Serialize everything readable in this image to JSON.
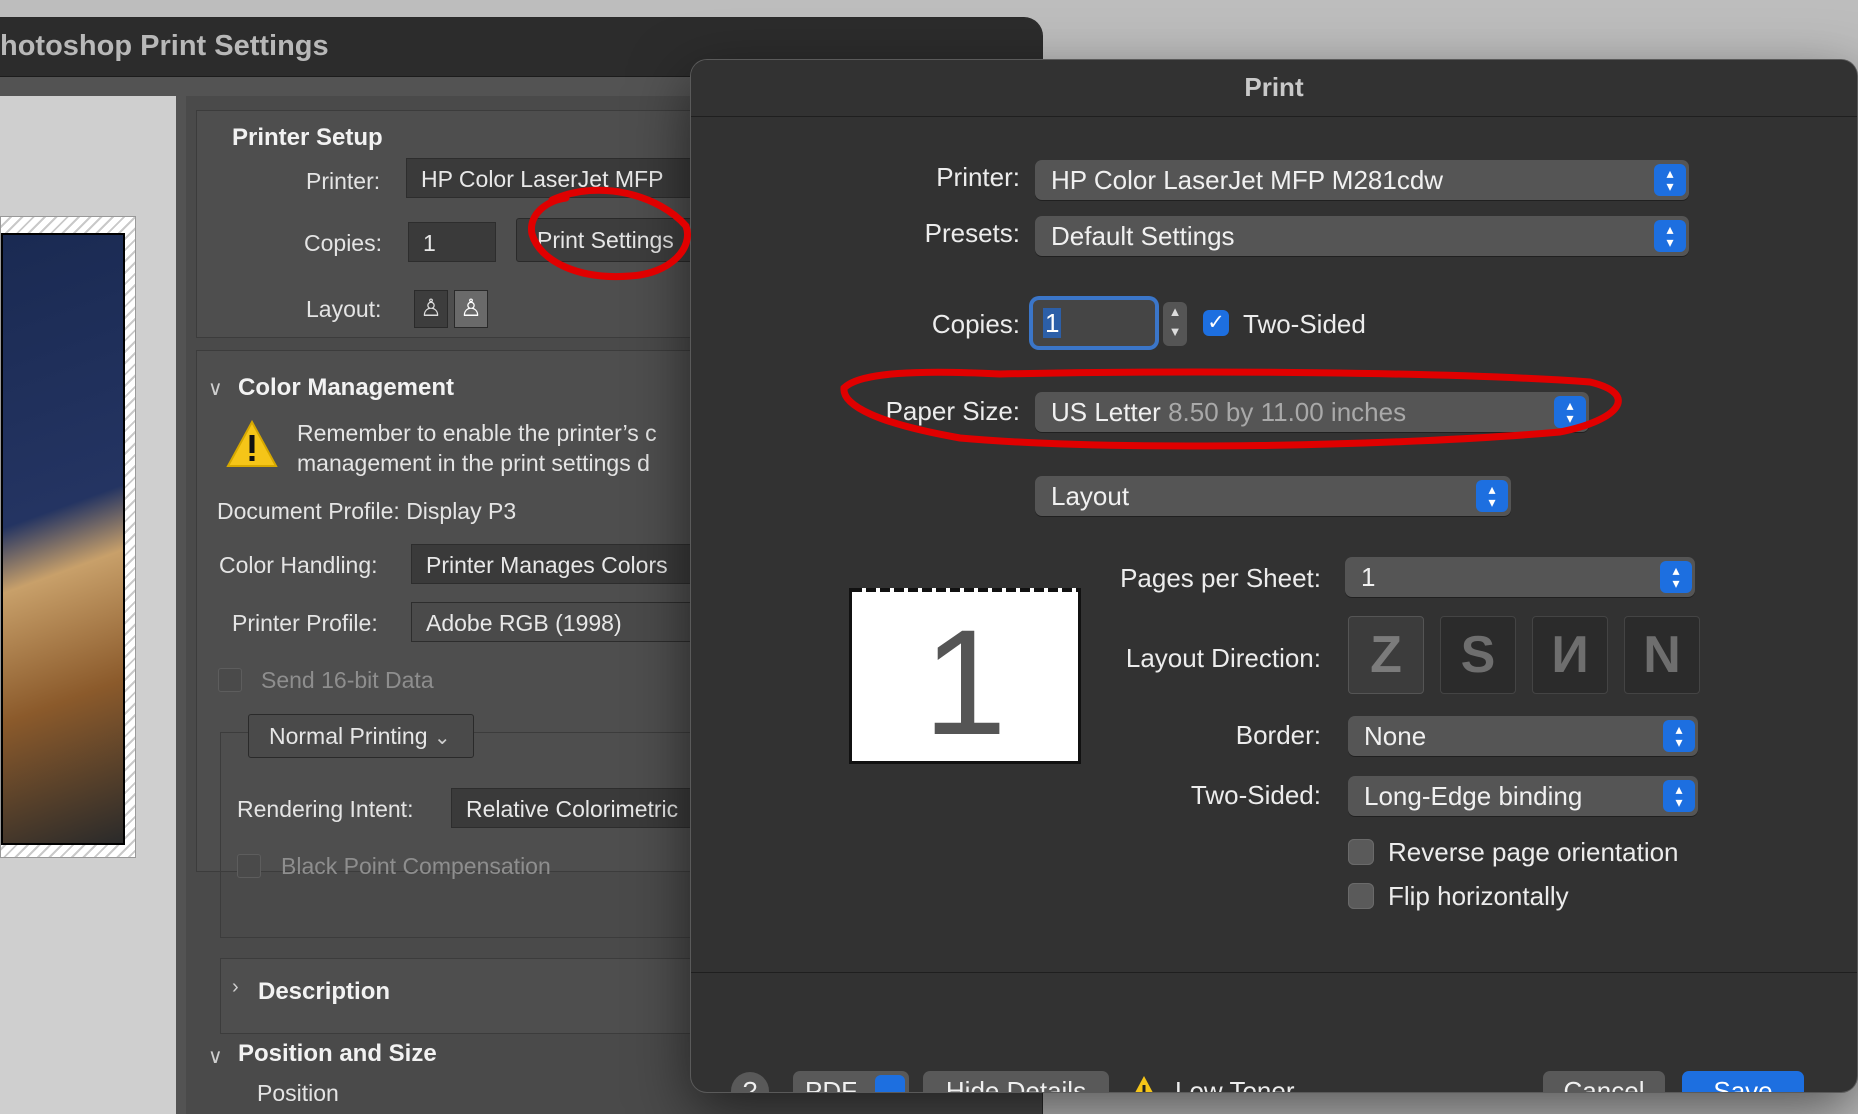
{
  "photoshop": {
    "title": "hotoshop Print Settings",
    "printer_setup": {
      "heading": "Printer Setup",
      "printer_label": "Printer:",
      "printer_value": "HP Color LaserJet MFP",
      "copies_label": "Copies:",
      "copies_value": "1",
      "print_settings_button": "Print Settings",
      "layout_label": "Layout:"
    },
    "color_management": {
      "heading": "Color Management",
      "warning_line1": "Remember to enable the printer’s c",
      "warning_line2": "management in the print settings d",
      "document_profile": "Document Profile: Display P3",
      "color_handling_label": "Color Handling:",
      "color_handling_value": "Printer Manages Colors",
      "printer_profile_label": "Printer Profile:",
      "printer_profile_value": "Adobe RGB (1998)",
      "send16_label": "Send 16-bit Data",
      "normal_printing": "Normal Printing",
      "rendering_intent_label": "Rendering Intent:",
      "rendering_intent_value": "Relative Colorimetric",
      "black_point_label": "Black Point Compensation"
    },
    "description": {
      "heading": "Description"
    },
    "position_size": {
      "heading": "Position and Size",
      "position_label": "Position"
    }
  },
  "print_dialog": {
    "title": "Print",
    "printer_label": "Printer:",
    "printer_value": "HP Color LaserJet MFP M281cdw",
    "presets_label": "Presets:",
    "presets_value": "Default Settings",
    "copies_label": "Copies:",
    "copies_value": "1",
    "two_sided_check_label": "Two-Sided",
    "two_sided_checked": true,
    "paper_size_label": "Paper Size:",
    "paper_size_value": "US Letter",
    "paper_size_detail": "8.50 by 11.00 inches",
    "section_value": "Layout",
    "preview_page_number": "1",
    "pages_per_sheet_label": "Pages per Sheet:",
    "pages_per_sheet_value": "1",
    "layout_direction_label": "Layout Direction:",
    "layout_direction_options": [
      "Z",
      "S",
      "И",
      "N"
    ],
    "border_label": "Border:",
    "border_value": "None",
    "two_sided_label": "Two-Sided:",
    "two_sided_value": "Long-Edge binding",
    "reverse_orientation_label": "Reverse page orientation",
    "flip_horizontally_label": "Flip horizontally",
    "footer": {
      "help": "?",
      "pdf": "PDF",
      "hide_details": "Hide Details",
      "low_toner": "Low Toner",
      "cancel": "Cancel",
      "save": "Save"
    },
    "accent_color": "#1d6fe0"
  },
  "annotations": {
    "color": "#e00000"
  }
}
